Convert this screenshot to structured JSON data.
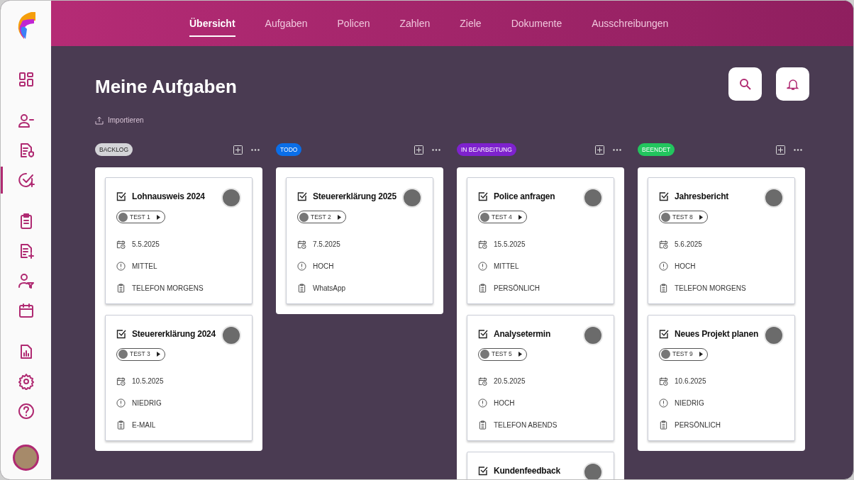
{
  "sidebar": {
    "items": [
      {
        "selected": false
      },
      {
        "selected": false
      },
      {
        "selected": false
      },
      {
        "selected": true
      },
      {
        "selected": false
      },
      {
        "selected": false
      },
      {
        "selected": false
      },
      {
        "selected": false
      },
      {
        "selected": false
      },
      {
        "selected": false
      },
      {
        "selected": false
      }
    ]
  },
  "nav": {
    "tabs": [
      {
        "label": "Übersicht",
        "selected": true
      },
      {
        "label": "Aufgaben",
        "selected": false
      },
      {
        "label": "Policen",
        "selected": false
      },
      {
        "label": "Zahlen",
        "selected": false
      },
      {
        "label": "Ziele",
        "selected": false
      },
      {
        "label": "Dokumente",
        "selected": false
      },
      {
        "label": "Ausschreibungen",
        "selected": false
      }
    ]
  },
  "page": {
    "title": "Meine Aufgaben",
    "import_label": "Importieren"
  },
  "columns": [
    {
      "status": "BACKLOG",
      "color": "#d4d4d8",
      "cards": [
        {
          "title": "Lohnausweis 2024",
          "tag": "TEST 1",
          "date": "5.5.2025",
          "priority": "MITTEL",
          "contact": "TELEFON MORGENS"
        },
        {
          "title": "Steuererklärung 2024",
          "tag": "TEST 3",
          "date": "10.5.2025",
          "priority": "NIEDRIG",
          "contact": "E-MAIL"
        }
      ]
    },
    {
      "status": "TODO",
      "color": "#0a6ee8",
      "cards": [
        {
          "title": "Steuererklärung 2025",
          "tag": "TEST 2",
          "date": "7.5.2025",
          "priority": "HOCH",
          "contact": "WhatsApp"
        }
      ]
    },
    {
      "status": "IN BEARBEITUNG",
      "color": "#7e22ce",
      "cards": [
        {
          "title": "Police anfragen",
          "tag": "TEST 4",
          "date": "15.5.2025",
          "priority": "MITTEL",
          "contact": "PERSÖNLICH"
        },
        {
          "title": "Analysetermin",
          "tag": "TEST 5",
          "date": "20.5.2025",
          "priority": "HOCH",
          "contact": "TELEFON ABENDS"
        },
        {
          "title": "Kundenfeedback"
        }
      ]
    },
    {
      "status": "BEENDET",
      "color": "#22c55e",
      "cards": [
        {
          "title": "Jahresbericht",
          "tag": "TEST 8",
          "date": "5.6.2025",
          "priority": "HOCH",
          "contact": "TELEFON MORGENS"
        },
        {
          "title": "Neues Projekt planen",
          "tag": "TEST 9",
          "date": "10.6.2025",
          "priority": "NIEDRIG",
          "contact": "PERSÖNLICH"
        }
      ]
    }
  ]
}
